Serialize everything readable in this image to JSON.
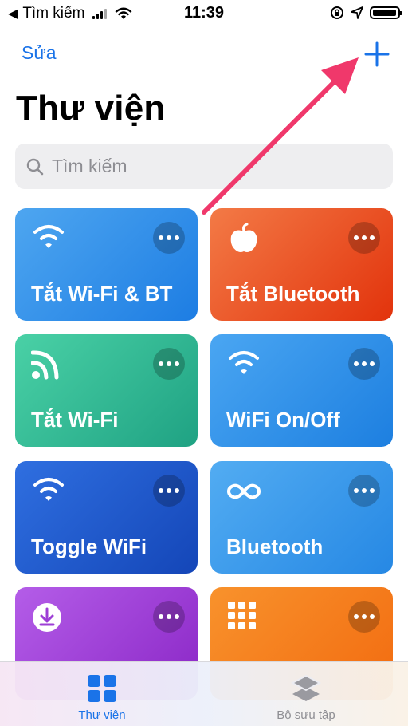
{
  "status_bar": {
    "back_app": "Tìm kiếm",
    "time": "11:39",
    "battery_level": 0.95
  },
  "nav": {
    "edit_label": "Sửa",
    "add_icon": "plus-icon"
  },
  "page_title": "Thư viện",
  "search": {
    "placeholder": "Tìm kiếm",
    "icon": "search-icon"
  },
  "shortcuts": [
    {
      "label": "Tắt Wi-Fi & BT",
      "icon": "wifi-icon",
      "color": "#2a8ae8"
    },
    {
      "label": "Tắt Bluetooth",
      "icon": "apple-icon",
      "color": "#ea4f1e"
    },
    {
      "label": "Tắt Wi-Fi",
      "icon": "rss-icon",
      "color": "#2fb893"
    },
    {
      "label": "WiFi On/Off",
      "icon": "wifi-icon",
      "color": "#2a8ae8"
    },
    {
      "label": "Toggle WiFi",
      "icon": "wifi-icon",
      "color": "#1f58cc"
    },
    {
      "label": "Bluetooth",
      "icon": "infinity-icon",
      "color": "#3596ea"
    },
    {
      "label": "",
      "icon": "download-icon",
      "color": "#9d3ed6"
    },
    {
      "label": "",
      "icon": "grid-icon",
      "color": "#f57c1e"
    }
  ],
  "tabbar": {
    "items": [
      {
        "label": "Thư viện",
        "icon": "grid-2x2-icon",
        "active": true
      },
      {
        "label": "Bộ sưu tập",
        "icon": "layers-icon",
        "active": false
      }
    ]
  },
  "colors": {
    "accent": "#1a73e8",
    "annotation_arrow": "#f0386b"
  }
}
